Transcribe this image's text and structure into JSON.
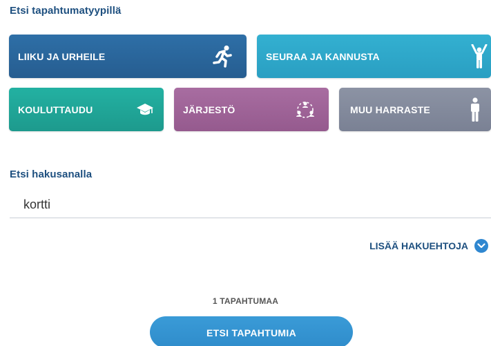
{
  "search_by_type": {
    "heading": "Etsi tapahtumatyypillä",
    "types": [
      {
        "label": "LIIKU JA URHEILE",
        "icon": "running-person-icon",
        "color": "#2b67a0"
      },
      {
        "label": "SEURAA JA KANNUSTA",
        "icon": "cheering-person-icon",
        "color": "#2fa9cc"
      },
      {
        "label": "KOULUTTAUDU",
        "icon": "graduation-cap-icon",
        "color": "#21a99a"
      },
      {
        "label": "JÄRJESTÖ",
        "icon": "group-people-icon",
        "color": "#9f6498"
      },
      {
        "label": "MUU HARRASTE",
        "icon": "standing-person-icon",
        "color": "#858c9e"
      }
    ]
  },
  "search_by_keyword": {
    "heading": "Etsi hakusanalla",
    "value": "kortti"
  },
  "more_criteria": {
    "label": "LISÄÄ HAKUEHTOJA",
    "icon": "chevron-down-icon"
  },
  "results": {
    "count_label": "1 TAPAHTUMAA"
  },
  "submit": {
    "label": "ETSI TAPAHTUMIA"
  }
}
